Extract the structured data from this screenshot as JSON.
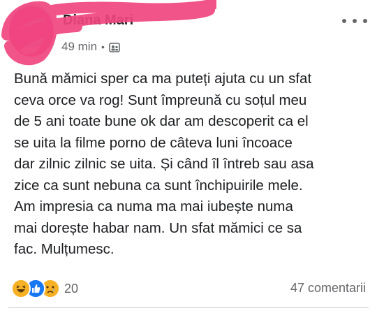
{
  "post": {
    "author_name": "Diana Mari",
    "timestamp": "49 min",
    "separator": "•",
    "privacy_icon": "friends-icon",
    "more_icon": "more-horizontal-icon",
    "lines": [
      "Bună mămici sper ca ma puteți ajuta cu un sfat",
      "ceva orce va rog! Sunt împreună cu soțul meu",
      "de 5 ani toate bune ok dar am descoperit ca el",
      "se uita la filme porno de câteva luni încoace",
      "dar zilnic zilnic se uita. Și când îl întreb sau asa",
      "zice ca sunt nebuna ca sunt închipuirile mele.",
      "Am impresia ca numa ma mai iubește numa",
      "mai dorește habar nam. Un sfat mămici ce sa",
      "fac. Mulțumesc."
    ],
    "reactions": {
      "icons": [
        "haha-reaction-icon",
        "like-reaction-icon",
        "sad-reaction-icon"
      ],
      "count": "20"
    },
    "comments_label": "47 comentarii",
    "colors": {
      "text": "#1c1e21",
      "secondary": "#65676b",
      "like": "#1877f2",
      "emoji": "#f7b125",
      "redaction": "#f0457f"
    }
  }
}
